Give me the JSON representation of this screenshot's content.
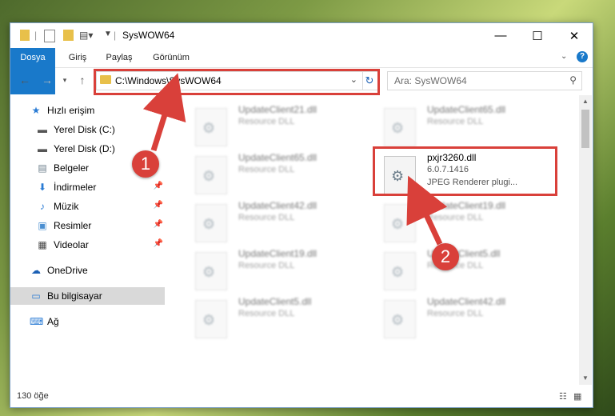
{
  "window": {
    "title": "SysWOW64",
    "controls": {
      "minimize": "—",
      "maximize": "☐",
      "close": "✕"
    }
  },
  "ribbon": {
    "tabs": [
      "Dosya",
      "Giriş",
      "Paylaş",
      "Görünüm"
    ]
  },
  "address_bar": {
    "path": "C:\\Windows\\SysWOW64",
    "search_placeholder": "Ara: SysWOW64"
  },
  "sidebar": {
    "items": [
      {
        "label": "Hızlı erişim",
        "icon": "star-icon"
      },
      {
        "label": "Yerel Disk (C:)",
        "icon": "drive-icon"
      },
      {
        "label": "Yerel Disk (D:)",
        "icon": "drive-icon"
      },
      {
        "label": "Belgeler",
        "icon": "documents-icon"
      },
      {
        "label": "İndirmeler",
        "icon": "download-icon"
      },
      {
        "label": "Müzik",
        "icon": "music-icon"
      },
      {
        "label": "Resimler",
        "icon": "pictures-icon"
      },
      {
        "label": "Videolar",
        "icon": "video-icon"
      },
      {
        "label": "OneDrive",
        "icon": "cloud-icon"
      },
      {
        "label": "Bu bilgisayar",
        "icon": "computer-icon",
        "selected": true
      },
      {
        "label": "Ağ",
        "icon": "network-icon"
      }
    ]
  },
  "files": [
    {
      "name": "UpdateClient21.dll",
      "type": "Resource DLL"
    },
    {
      "name": "UpdateClient65.dll",
      "type": "Resource DLL"
    },
    {
      "name": "UpdateClient65.dll",
      "type": "Resource DLL"
    },
    {
      "name": "pxjr3260.dll",
      "version": "6.0.7.1416",
      "description": "JPEG Renderer plugi...",
      "highlighted": true
    },
    {
      "name": "UpdateClient42.dll",
      "type": "Resource DLL"
    },
    {
      "name": "UpdateClient19.dll",
      "type": "Resource DLL"
    },
    {
      "name": "UpdateClient19.dll",
      "type": "Resource DLL"
    },
    {
      "name": "UpdateClient5.dll",
      "type": "Resource DLL"
    },
    {
      "name": "UpdateClient5.dll",
      "type": "Resource DLL"
    },
    {
      "name": "UpdateClient42.dll",
      "type": "Resource DLL"
    }
  ],
  "status": {
    "item_count": "130 öğe"
  },
  "callouts": [
    "1",
    "2"
  ],
  "colors": {
    "accent": "#1979ca",
    "highlight": "#d9403a"
  }
}
